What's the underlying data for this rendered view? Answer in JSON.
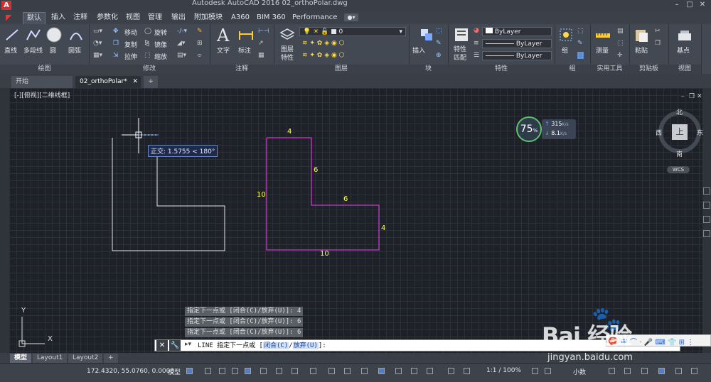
{
  "titlebar": {
    "title": "Autodesk AutoCAD 2016    02_orthoPolar.dwg"
  },
  "ribbon_tabs": [
    "默认",
    "插入",
    "注释",
    "参数化",
    "视图",
    "管理",
    "输出",
    "附加模块",
    "A360",
    "BIM 360",
    "Performance"
  ],
  "ribbon": {
    "draw": {
      "label": "绘图",
      "items": [
        "直线",
        "多段线",
        "圆",
        "圆弧"
      ]
    },
    "modify": {
      "label": "修改",
      "items": [
        "移动",
        "旋转",
        "复制",
        "镜像",
        "拉伸",
        "缩放"
      ]
    },
    "annotation": {
      "label": "注释",
      "items": [
        "文字",
        "标注"
      ]
    },
    "layers": {
      "label": "图层",
      "items": [
        "图层",
        "特性"
      ],
      "layer_value": "0"
    },
    "block": {
      "label": "块",
      "items": [
        "插入"
      ]
    },
    "properties": {
      "label": "特性",
      "items": [
        "特性",
        "匹配"
      ],
      "bylayer1": "ByLayer",
      "bylayer2": "ByLayer",
      "bylayer3": "ByLayer"
    },
    "groups": {
      "label": "组",
      "items": [
        "组"
      ]
    },
    "utilities": {
      "label": "实用工具",
      "items": [
        "测量"
      ]
    },
    "clipboard": {
      "label": "剪贴板",
      "items": [
        "粘贴"
      ]
    },
    "view": {
      "label": "视图",
      "items": [
        "基点"
      ]
    }
  },
  "doc_tabs": [
    "开始",
    "02_orthoPolar*"
  ],
  "viewport_label": "[-][俯视][二维线框]",
  "tooltip": "正交: 1.5755 < 180°",
  "dimensions": {
    "top": "4",
    "inner_vertical": "6",
    "left": "10",
    "inner_horizontal": "6",
    "right": "4",
    "bottom": "10"
  },
  "perf_widget": {
    "percent": "75",
    "unit": "%",
    "upload": "315",
    "up_unit": "K/s",
    "download": "8.1",
    "down_unit": "K/s"
  },
  "viewcube": {
    "north": "北",
    "south": "南",
    "west": "西",
    "east": "东",
    "face": "上",
    "wcs": "WCS"
  },
  "ucs": {
    "x": "X",
    "y": "Y"
  },
  "command_history": [
    "指定下一点或 [闭合(C)/放弃(U)]: 4",
    "指定下一点或 [闭合(C)/放弃(U)]: 6",
    "指定下一点或 [闭合(C)/放弃(U)]: 6"
  ],
  "command_line": {
    "prefix": "LINE 指定下一点或 [",
    "opt1": "闭合(C)",
    "opt2": "放弃(U)",
    "suffix": "]:"
  },
  "layout_tabs": [
    "模型",
    "Layout1",
    "Layout2"
  ],
  "status_bar": {
    "coords": "172.4320, 55.0760, 0.0000",
    "mode": "模型",
    "scale": "1:1 / 100%",
    "units": "小数"
  },
  "watermark": {
    "brand": "Bai 经验",
    "url": "jingyan.baidu.com"
  },
  "colors": {
    "accent": "#e23b3b",
    "shape": "#c63cc6",
    "dimension": "#ffff52",
    "background": "#1e2127"
  }
}
